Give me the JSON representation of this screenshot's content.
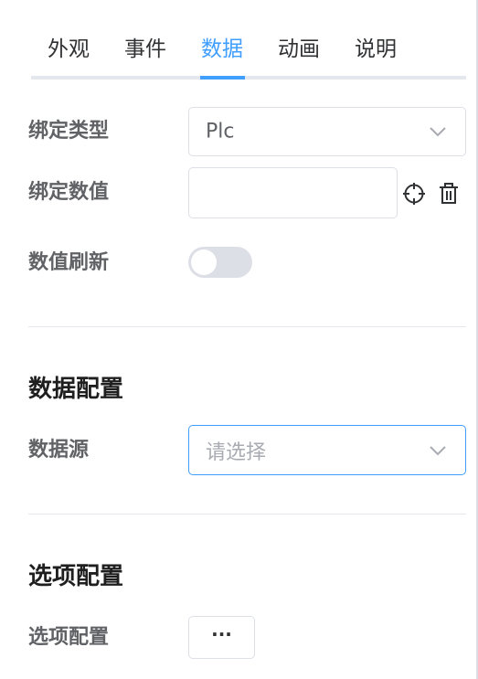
{
  "tabs": [
    {
      "label": "外观"
    },
    {
      "label": "事件"
    },
    {
      "label": "数据"
    },
    {
      "label": "动画"
    },
    {
      "label": "说明"
    }
  ],
  "active_tab": "数据",
  "accent_color": "#409eff",
  "binding": {
    "type_label": "绑定类型",
    "type_value": "Plc",
    "value_label": "绑定数值",
    "value_input": "",
    "value_icons": [
      "crosshair-icon",
      "trash-icon"
    ],
    "refresh_label": "数值刷新",
    "refresh_enabled": false
  },
  "data_config": {
    "title": "数据配置",
    "source_label": "数据源",
    "source_placeholder": "请选择"
  },
  "option_config": {
    "title": "选项配置",
    "label": "选项配置",
    "button_label": "···"
  }
}
